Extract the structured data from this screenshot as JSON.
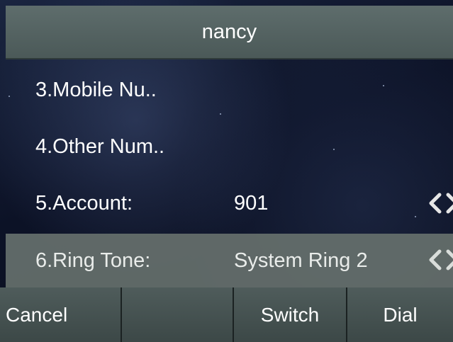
{
  "title": "nancy",
  "menu": {
    "items": [
      {
        "label": "3.Mobile Nu..",
        "value": ""
      },
      {
        "label": "4.Other Num..",
        "value": ""
      },
      {
        "label": "5.Account:",
        "value": "901"
      },
      {
        "label": "6.Ring Tone:",
        "value": "System Ring 2"
      }
    ],
    "selected_index": 3
  },
  "softkeys": [
    "Cancel",
    "",
    "Switch",
    "Dial"
  ],
  "colors": {
    "title_bar": "#55636a",
    "selected_row": "#66706c",
    "softkey_bg": "#4a5756",
    "text": "#ffffff",
    "background": "#0c1226"
  },
  "icons": {
    "value_selector": "left-right-arrows-icon"
  }
}
